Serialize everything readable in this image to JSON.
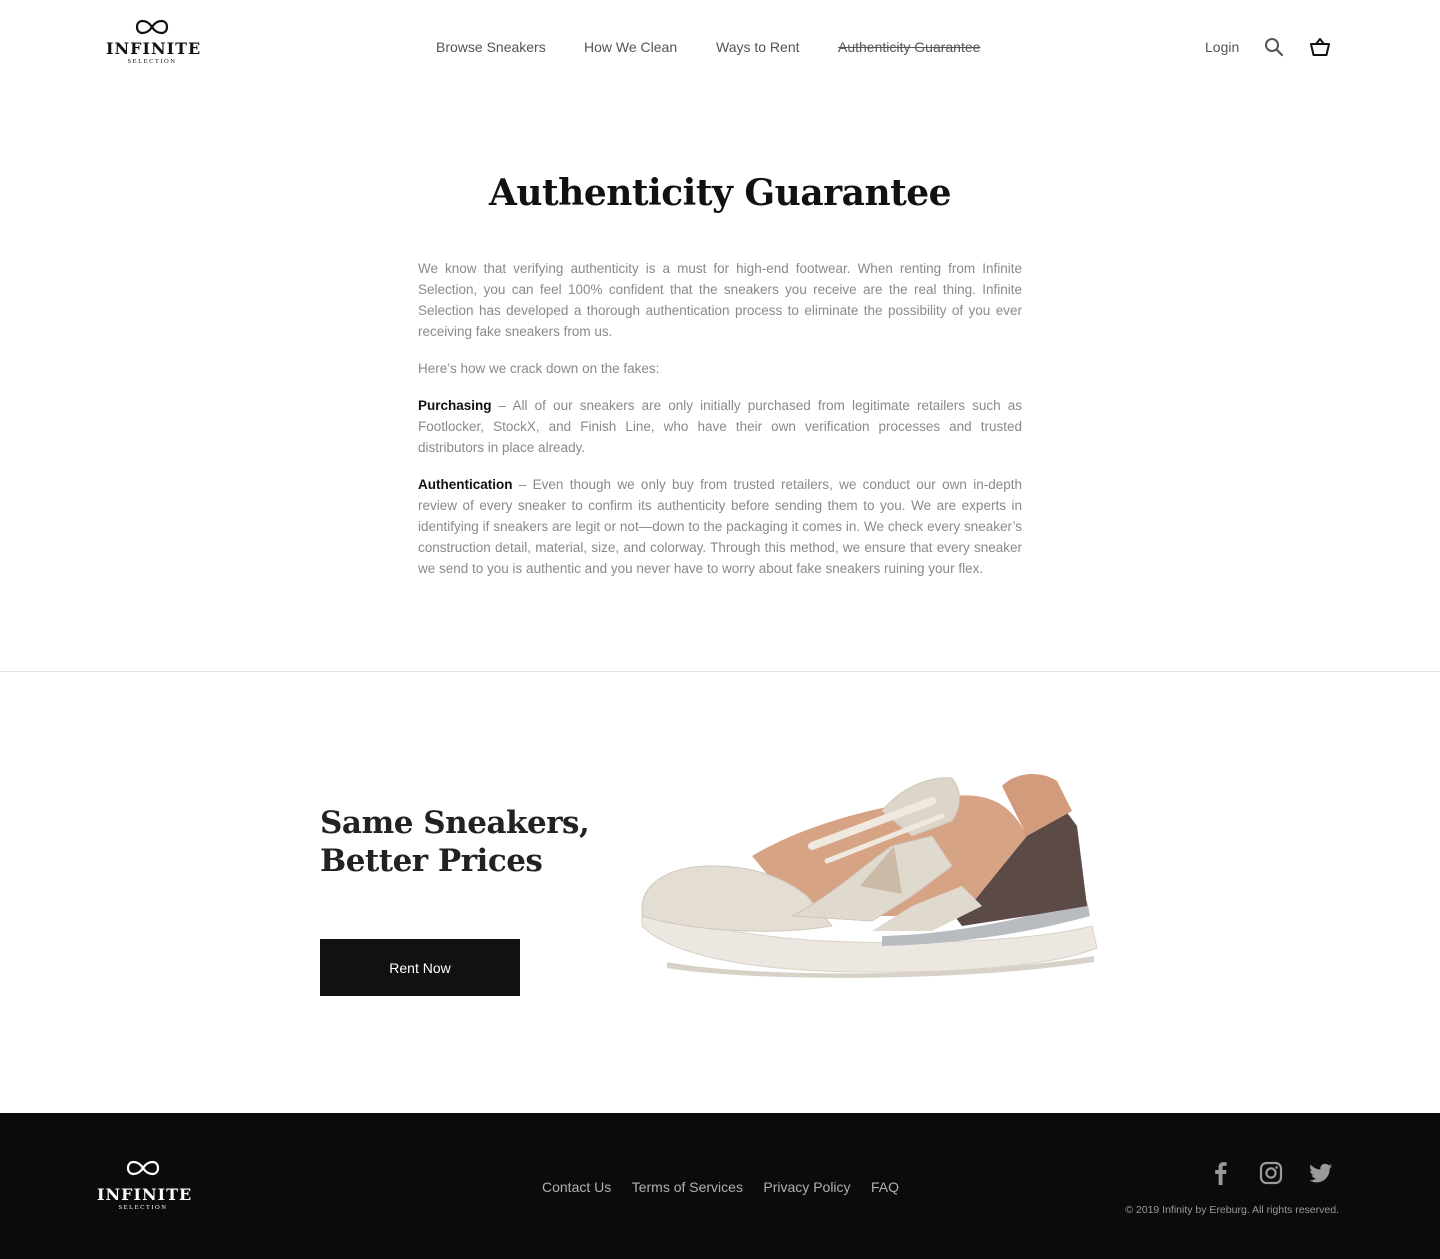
{
  "header": {
    "brand": {
      "name": "INFINITE",
      "tagline": "SELECTION"
    },
    "nav": [
      {
        "label": "Browse Sneakers"
      },
      {
        "label": "How We Clean"
      },
      {
        "label": "Ways to Rent"
      },
      {
        "label": "Authenticity Guarantee",
        "active": true
      }
    ],
    "login_label": "Login",
    "icons": [
      "search-icon",
      "cart-icon"
    ]
  },
  "main": {
    "title": "Authenticity Guarantee",
    "intro": "We know that verifying authenticity is a must for high-end footwear. When renting from Infinite Selection, you can feel 100% confident that the sneakers you receive are the real thing. Infinite Selection has developed a thorough authentication process to eliminate the possibility of you ever receiving fake sneakers from us.",
    "lead": "Here’s how we crack down on the fakes:",
    "sections": [
      {
        "heading": "Purchasing",
        "text": " – All of our sneakers are only initially purchased from legitimate retailers such as Footlocker, StockX, and Finish Line, who have their own verification processes and trusted distributors in place already."
      },
      {
        "heading": "Authentication",
        "text": " – Even though we only buy from trusted retailers, we conduct our own in-depth review of every sneaker to confirm its authenticity before sending them to you. We are experts in identifying if sneakers are legit or not—down to the packaging it comes in. We check every sneaker’s construction detail, material, size, and colorway. Through this method, we ensure that every sneaker we send to you is authentic and you never have to worry about fake sneakers ruining your flex."
      }
    ]
  },
  "promo": {
    "title_line1": "Same Sneakers,",
    "title_line2": "Better Prices",
    "button_label": "Rent Now",
    "image": "sneaker-photo"
  },
  "footer": {
    "brand": {
      "name": "INFINITE",
      "tagline": "SELECTION"
    },
    "links": [
      {
        "label": "Contact Us"
      },
      {
        "label": "Terms of Services"
      },
      {
        "label": "Privacy Policy"
      },
      {
        "label": "FAQ"
      }
    ],
    "social_icons": [
      "facebook-icon",
      "instagram-icon",
      "twitter-icon"
    ],
    "copyright": "© 2019 Infinity by Ereburg. All rights reserved."
  },
  "colors": {
    "text_dark": "#111111",
    "text_muted": "#8a8a8a",
    "footer_bg": "#0b0b0b",
    "button_bg": "#111111"
  }
}
